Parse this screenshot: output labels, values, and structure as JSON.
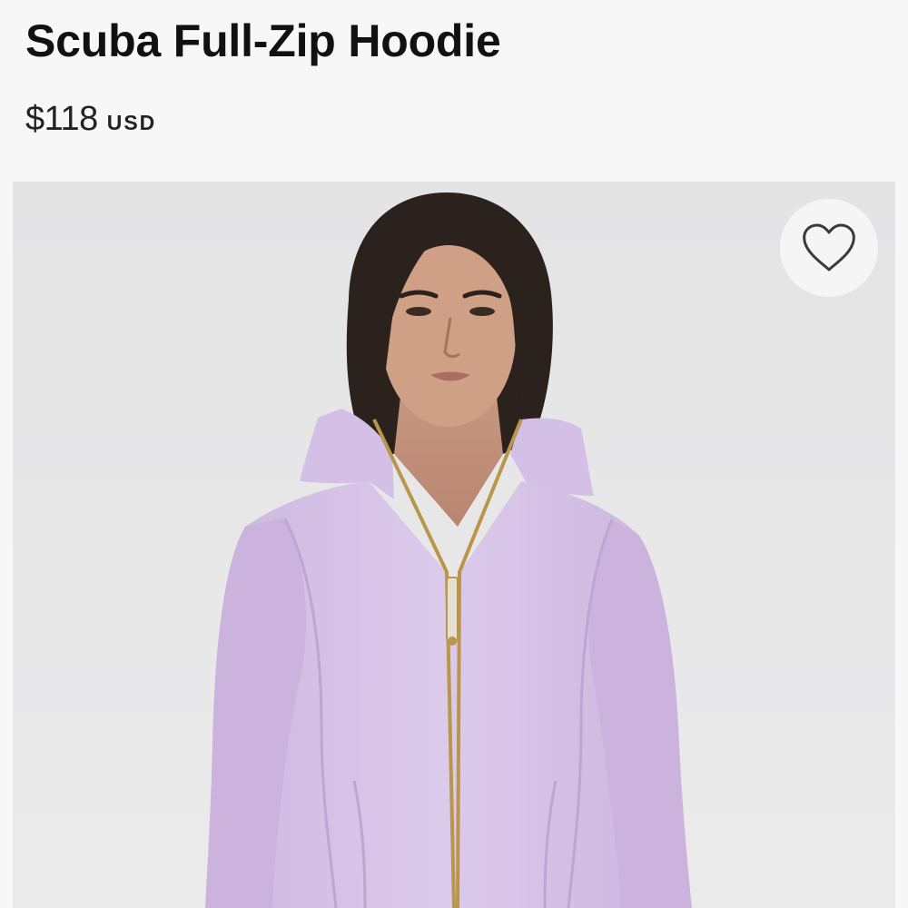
{
  "product": {
    "title": "Scuba Full-Zip Hoodie",
    "price": "$118",
    "currency": "USD"
  },
  "image": {
    "description_icon": "product-photo",
    "hoodie_color": "#d9c6e8"
  },
  "wishlist": {
    "icon": "heart-icon",
    "state": "not-favorited"
  },
  "colors": {
    "background": "#f7f7f7",
    "text": "#111111",
    "photo_backdrop": "#e6e6e7"
  }
}
